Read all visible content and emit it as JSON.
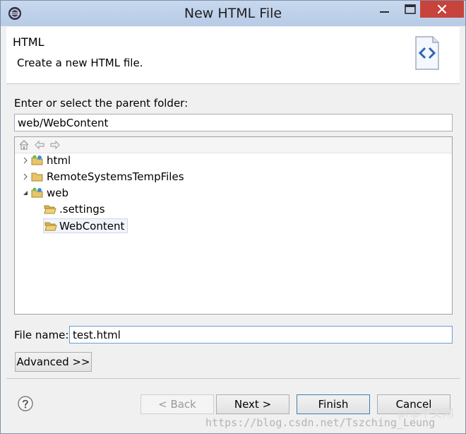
{
  "window": {
    "title": "New HTML File"
  },
  "header": {
    "title": "HTML",
    "description": "Create a new HTML file."
  },
  "folder": {
    "label": "Enter or select the parent folder:",
    "value": "web/WebContent"
  },
  "tree": {
    "items": [
      {
        "label": "html"
      },
      {
        "label": "RemoteSystemsTempFiles"
      },
      {
        "label": "web"
      },
      {
        "label": ".settings"
      },
      {
        "label": "WebContent"
      }
    ]
  },
  "filename": {
    "label": "File name:",
    "value": "test.html"
  },
  "buttons": {
    "advanced": "Advanced >>",
    "back": "< Back",
    "next": "Next >",
    "finish": "Finish",
    "cancel": "Cancel"
  },
  "watermark": {
    "url": "https://blog.csdn.net/Tszching_Leung",
    "badge": "php中文网"
  },
  "colors": {
    "titlebar": "#b7cbe6",
    "close_button": "#c7433b",
    "selection": "#f1f5fb",
    "focus_border": "#6a9fd8"
  }
}
